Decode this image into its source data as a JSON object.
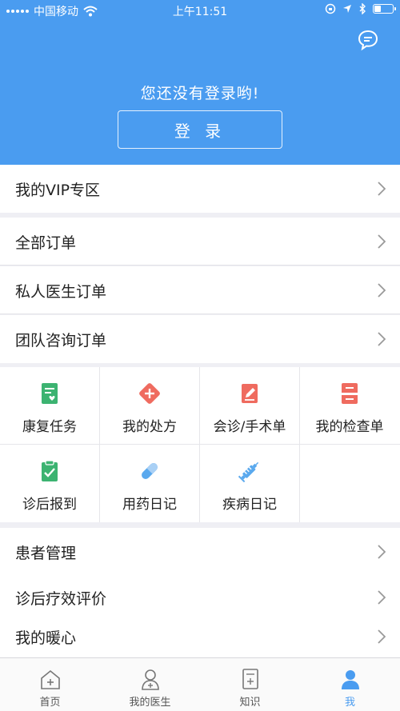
{
  "status_bar": {
    "carrier": "中国移动",
    "time": "上午11:51"
  },
  "header": {
    "login_hint": "您还没有登录哟!",
    "login_button": "登 录",
    "chat_icon": "chat-bubble-icon"
  },
  "vip_row": {
    "label": "我的VIP专区"
  },
  "order_rows": [
    {
      "label": "全部订单"
    },
    {
      "label": "私人医生订单"
    },
    {
      "label": "团队咨询订单"
    }
  ],
  "grid_items": [
    {
      "label": "康复任务",
      "icon": "rehab-task-icon",
      "color": "#3cb371"
    },
    {
      "label": "我的处方",
      "icon": "prescription-icon",
      "color": "#ef6b5f"
    },
    {
      "label": "会诊/手术单",
      "icon": "consultation-form-icon",
      "color": "#ef6b5f"
    },
    {
      "label": "我的检查单",
      "icon": "exam-sheet-icon",
      "color": "#ef6b5f"
    },
    {
      "label": "诊后报到",
      "icon": "checkin-clipboard-icon",
      "color": "#3cb371"
    },
    {
      "label": "用药日记",
      "icon": "pill-icon",
      "color": "#5aa9ee"
    },
    {
      "label": "疾病日记",
      "icon": "syringe-icon",
      "color": "#5aa9ee"
    }
  ],
  "bottom_rows": [
    {
      "label": "患者管理"
    },
    {
      "label": "诊后疗效评价"
    },
    {
      "label": "我的暖心"
    }
  ],
  "tabs": [
    {
      "label": "首页",
      "icon": "home-icon"
    },
    {
      "label": "我的医生",
      "icon": "doctor-icon"
    },
    {
      "label": "知识",
      "icon": "knowledge-icon"
    },
    {
      "label": "我",
      "icon": "profile-icon"
    }
  ],
  "colors": {
    "primary": "#4a9cf0",
    "green": "#3cb371",
    "red": "#ef6b5f",
    "light_blue": "#5aa9ee"
  }
}
